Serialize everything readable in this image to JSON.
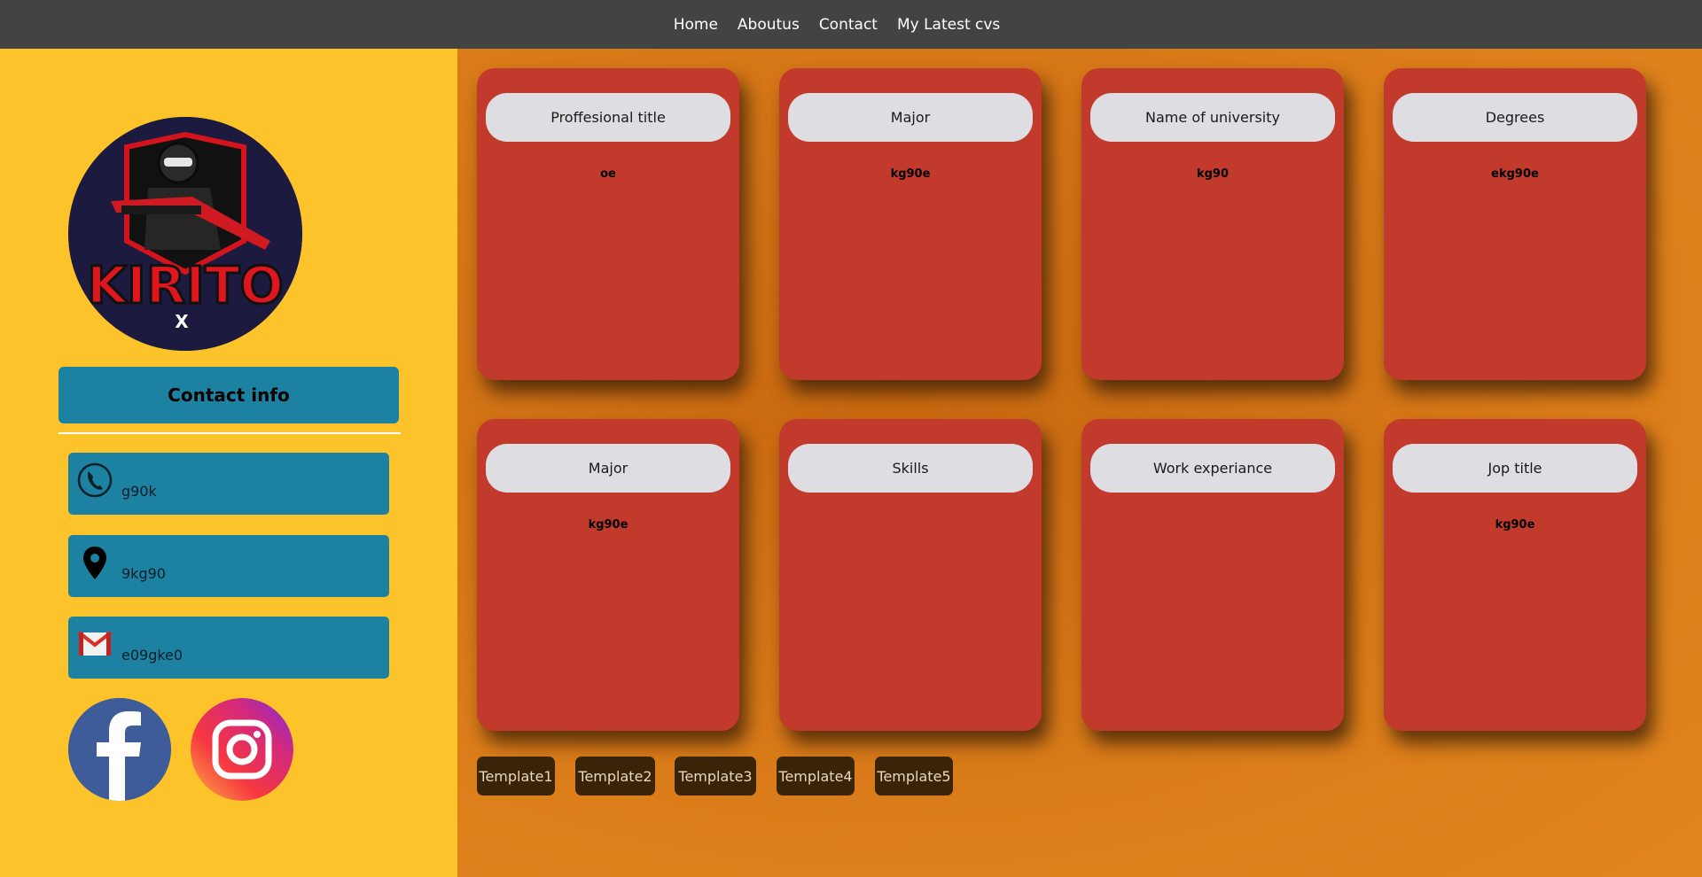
{
  "nav": {
    "items": [
      "Home",
      "Aboutus",
      "Contact",
      "My Latest cvs"
    ]
  },
  "sidebar": {
    "avatar_text": "KIRITO",
    "avatar_sub": "X",
    "contact_title": "Contact info",
    "contacts": [
      {
        "icon": "phone-icon",
        "value": "g90k"
      },
      {
        "icon": "location-pin-icon",
        "value": "9kg90"
      },
      {
        "icon": "gmail-icon",
        "value": "e09gke0"
      }
    ],
    "social": [
      {
        "icon": "facebook-icon"
      },
      {
        "icon": "instagram-icon"
      }
    ]
  },
  "cards": [
    {
      "title": "Proffesional title",
      "value": "oe"
    },
    {
      "title": "Major",
      "value": "kg90e"
    },
    {
      "title": "Name of university",
      "value": "kg90"
    },
    {
      "title": "Degrees",
      "value": "ekg90e"
    },
    {
      "title": "Major",
      "value": "kg90e"
    },
    {
      "title": "Skills",
      "value": ""
    },
    {
      "title": "Work experiance",
      "value": ""
    },
    {
      "title": "Jop title",
      "value": "kg90e"
    }
  ],
  "templates": [
    "Template1",
    "Template2",
    "Template3",
    "Template4",
    "Template5"
  ],
  "colors": {
    "nav_bg": "#434343",
    "sidebar_bg": "#fcc42a",
    "contact_bg": "#1d81a2",
    "card_bg": "#c23a2b",
    "pill_bg": "#dedee2",
    "template_btn_bg": "#3a2408"
  }
}
